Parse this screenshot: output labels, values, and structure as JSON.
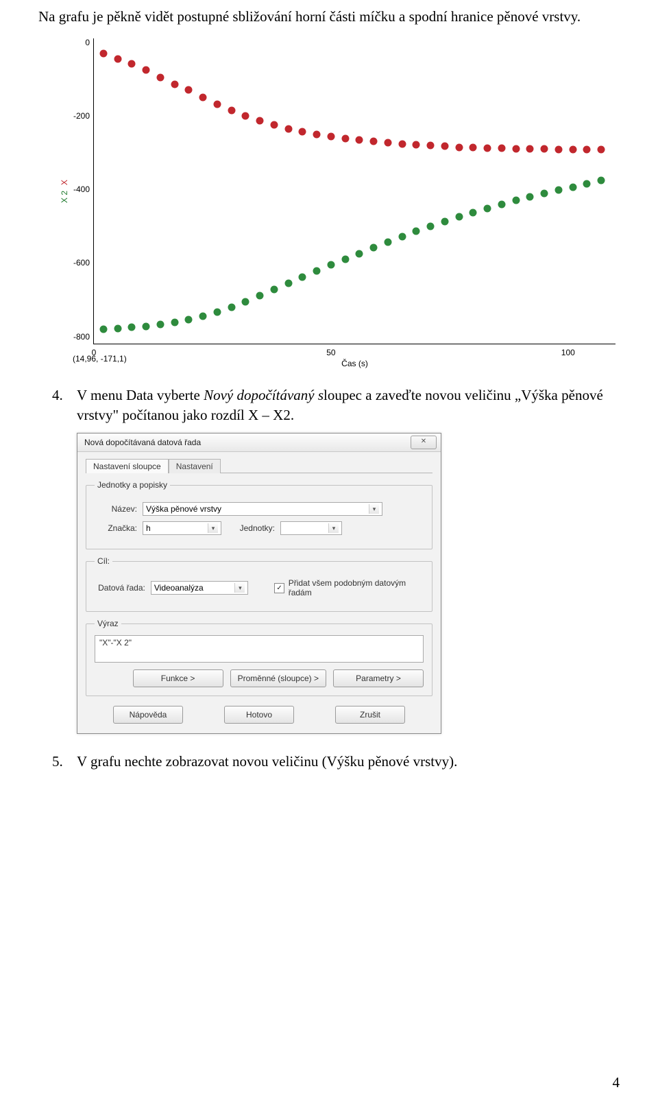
{
  "intro": "Na grafu je pěkně vidět postupné sbližování horní části míčku a spodní hranice pěnové vrstvy.",
  "chart_data": {
    "type": "scatter",
    "xlabel": "Čas (s)",
    "ylabel_series": [
      "X 2",
      "X"
    ],
    "x_ticks": [
      0,
      50,
      100
    ],
    "y_ticks": [
      0,
      -200,
      -400,
      -600,
      -800
    ],
    "xlim": [
      0,
      110
    ],
    "ylim": [
      -820,
      10
    ],
    "cursor_readout": "(14,96, -171,1)",
    "series": [
      {
        "name": "X",
        "color": "#c1272d",
        "x": [
          2,
          5,
          8,
          11,
          14,
          17,
          20,
          23,
          26,
          29,
          32,
          35,
          38,
          41,
          44,
          47,
          50,
          53,
          56,
          59,
          62,
          65,
          68,
          71,
          74,
          77,
          80,
          83,
          86,
          89,
          92,
          95,
          98,
          101,
          104,
          107
        ],
        "y": [
          -30,
          -45,
          -58,
          -75,
          -95,
          -115,
          -130,
          -150,
          -168,
          -185,
          -200,
          -213,
          -224,
          -235,
          -243,
          -250,
          -256,
          -261,
          -266,
          -270,
          -273,
          -276,
          -279,
          -281,
          -283,
          -285,
          -286,
          -287,
          -288,
          -289,
          -290,
          -290,
          -291,
          -291,
          -291,
          -292
        ]
      },
      {
        "name": "X 2",
        "color": "#2e8b3d",
        "x": [
          2,
          5,
          8,
          11,
          14,
          17,
          20,
          23,
          26,
          29,
          32,
          35,
          38,
          41,
          44,
          47,
          50,
          53,
          56,
          59,
          62,
          65,
          68,
          71,
          74,
          77,
          80,
          83,
          86,
          89,
          92,
          95,
          98,
          101,
          104,
          107
        ],
        "y": [
          -780,
          -778,
          -775,
          -772,
          -768,
          -762,
          -755,
          -745,
          -733,
          -720,
          -705,
          -688,
          -672,
          -655,
          -638,
          -622,
          -605,
          -590,
          -575,
          -558,
          -543,
          -528,
          -514,
          -500,
          -488,
          -475,
          -463,
          -452,
          -440,
          -430,
          -420,
          -410,
          -402,
          -394,
          -385,
          -375
        ]
      }
    ]
  },
  "step4": {
    "number": "4.",
    "text": "V menu Data vyberte Nový dopočítávaný sloupec a zaveďte novou veličinu „Výška pěnové vrstvy\" počítanou jako rozdíl X – X2.",
    "italic_span": "Nový dopočítávaný s"
  },
  "dialog": {
    "title": "Nová dopočítávaná datová řada",
    "tabs": [
      "Nastavení sloupce",
      "Nastavení"
    ],
    "units_group_title": "Jednotky a popisky",
    "name_label": "Název:",
    "name_value": "Výška pěnové vrstvy",
    "symbol_label": "Značka:",
    "symbol_value": "h",
    "units_label": "Jednotky:",
    "units_value": "",
    "target_group_title": "Cíl:",
    "series_label": "Datová řada:",
    "series_value": "Videoanalýza",
    "checkbox_label": "Přidat všem podobným datovým řadám",
    "checkbox_checked": true,
    "expr_group_title": "Výraz",
    "expr_value": "\"X\"-\"X 2\"",
    "btn_functions": "Funkce >",
    "btn_variables": "Proměnné (sloupce) >",
    "btn_params": "Parametry >",
    "btn_help": "Nápověda",
    "btn_done": "Hotovo",
    "btn_cancel": "Zrušit",
    "close_glyph": "✕"
  },
  "step5": {
    "number": "5.",
    "text": "V grafu nechte zobrazovat novou veličinu (Výšku pěnové vrstvy)."
  },
  "page_number": "4"
}
